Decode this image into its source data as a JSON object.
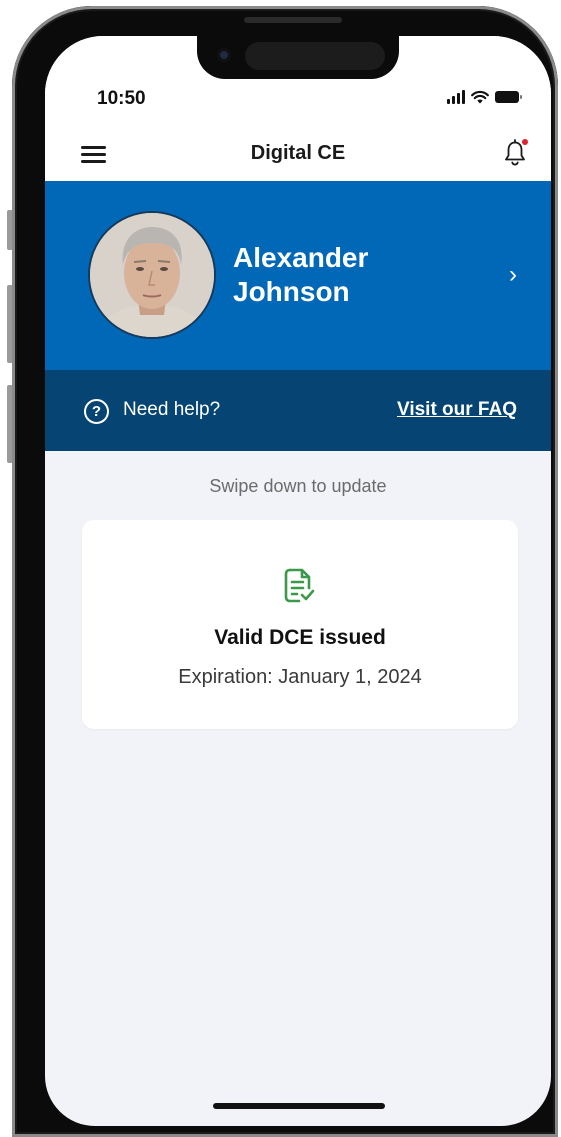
{
  "status_bar": {
    "time": "10:50",
    "icons": [
      "signal-icon",
      "wifi-icon",
      "battery-icon"
    ]
  },
  "header": {
    "title": "Digital CE",
    "menu_icon": "hamburger-menu-icon",
    "notification_icon": "bell-icon"
  },
  "profile": {
    "first_name": "Alexander",
    "last_name": "Johnson",
    "chevron": "›"
  },
  "help": {
    "icon_glyph": "?",
    "text": "Need help?",
    "link_text": "Visit our FAQ"
  },
  "swipe_hint": "Swipe down to update",
  "dce_card": {
    "title": "Valid DCE issued",
    "expiration": "Expiration: January 1, 2024",
    "icon": "document-check-icon"
  },
  "colors": {
    "primary_blue": "#0168b7",
    "dark_blue": "#054473",
    "background": "#f2f3f8",
    "success_green": "#3a9a4a",
    "notification_red": "#e0202d"
  }
}
